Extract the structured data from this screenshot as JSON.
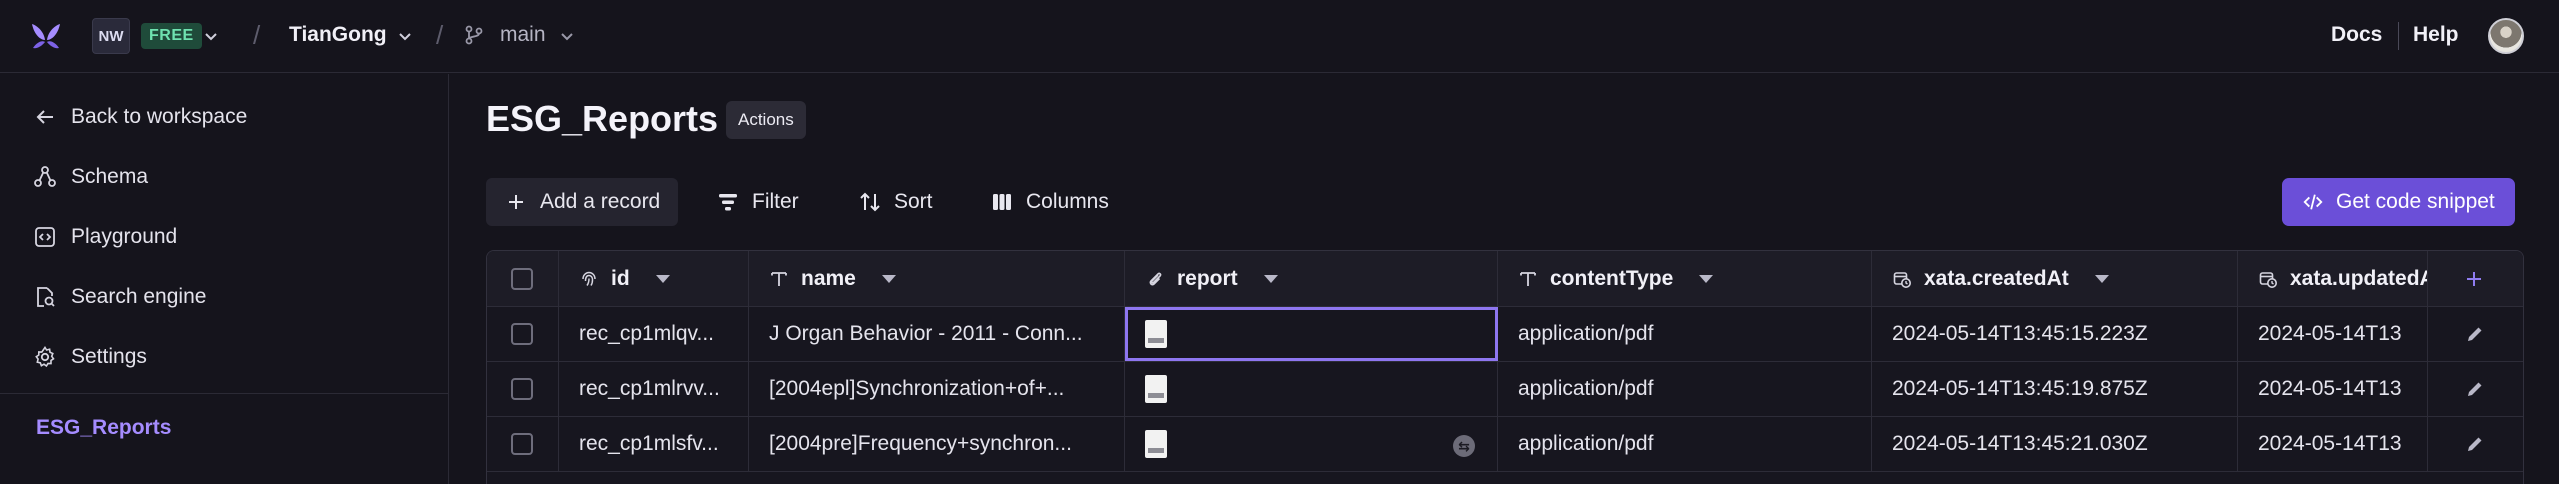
{
  "topbar": {
    "workspace_initials": "NW",
    "plan_badge": "FREE",
    "workspace_name": "TianGong",
    "branch": "main",
    "docs": "Docs",
    "help": "Help"
  },
  "sidebar": {
    "items": [
      {
        "label": "Back to workspace",
        "icon": "arrow-left-icon"
      },
      {
        "label": "Schema",
        "icon": "schema-icon"
      },
      {
        "label": "Playground",
        "icon": "code-box-icon"
      },
      {
        "label": "Search engine",
        "icon": "search-doc-icon"
      },
      {
        "label": "Settings",
        "icon": "gear-icon"
      }
    ],
    "table": "ESG_Reports"
  },
  "main": {
    "title": "ESG_Reports",
    "actions": "Actions",
    "toolbar": {
      "add_record": "Add a record",
      "filter": "Filter",
      "sort": "Sort",
      "columns": "Columns",
      "get_code": "Get code snippet"
    }
  },
  "table": {
    "columns": [
      {
        "label": "id",
        "icon": "fingerprint-icon"
      },
      {
        "label": "name",
        "icon": "text-type-icon"
      },
      {
        "label": "report",
        "icon": "paperclip-icon"
      },
      {
        "label": "contentType",
        "icon": "text-type-icon"
      },
      {
        "label": "xata.createdAt",
        "icon": "datetime-icon"
      },
      {
        "label": "xata.updatedA",
        "icon": "datetime-icon"
      }
    ],
    "rows": [
      {
        "id": "rec_cp1mlqv...",
        "name": "J Organ Behavior - 2011 - Conn...",
        "contentType": "application/pdf",
        "createdAt": "2024-05-14T13:45:15.223Z",
        "updatedAt": "2024-05-14T13"
      },
      {
        "id": "rec_cp1mlrvv...",
        "name": "[2004epl]Synchronization+of+...",
        "contentType": "application/pdf",
        "createdAt": "2024-05-14T13:45:19.875Z",
        "updatedAt": "2024-05-14T13"
      },
      {
        "id": "rec_cp1mlsfv...",
        "name": "[2004pre]Frequency+synchron...",
        "contentType": "application/pdf",
        "createdAt": "2024-05-14T13:45:21.030Z",
        "updatedAt": "2024-05-14T13"
      }
    ]
  },
  "colors": {
    "accent": "#6b4fd8",
    "accent_text": "#a58cff",
    "free_badge": "#1f4b3a"
  }
}
